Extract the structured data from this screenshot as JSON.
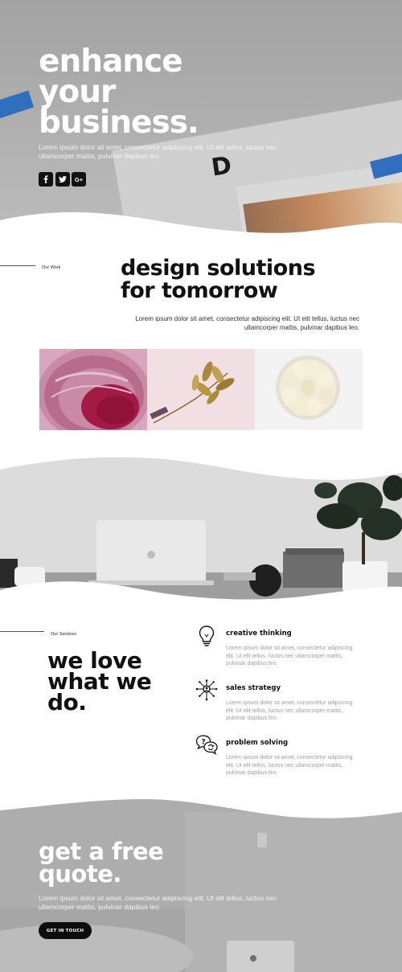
{
  "hero": {
    "title_line1": "enhance",
    "title_line2": "your",
    "title_line3": "business.",
    "text": "Lorem ipsum dolor sit amet, consectetur adipiscing elit. Ut elit tellus, luctus nec ullamcorper mattis, pulvinar dapibus leo.",
    "letter": "D",
    "social": [
      {
        "icon": "facebook-icon",
        "glyph": "f"
      },
      {
        "icon": "twitter-icon",
        "glyph": "t"
      },
      {
        "icon": "google-plus-icon",
        "glyph": "G+"
      }
    ]
  },
  "work": {
    "label": "Our Work",
    "title_line1": "design solutions",
    "title_line2": "for tomorrow",
    "text": "Lorem ipsum dolor sit amet, consectetur adipiscing elit. Ut elit tellus, luctus nec ullamcorper mattis, pulvinar dapibus leo.",
    "gallery": [
      "pink-dish-photo",
      "gold-branch-photo",
      "garlic-photo"
    ]
  },
  "services": {
    "label": "Our Services",
    "title_line1": "we love",
    "title_line2": "what we",
    "title_line3": "do.",
    "items": [
      {
        "icon": "lightbulb-icon",
        "name": "creative thinking",
        "desc": "Lorem ipsum dolor sit amet, consectetur adipiscing elit. Ut elit tellus, luctus nec ullamcorper mattis, pulvinar dapibus leo."
      },
      {
        "icon": "network-icon",
        "name": "sales strategy",
        "desc": "Lorem ipsum dolor sit amet, consectetur adipiscing elit. Ut elit tellus, luctus nec ullamcorper mattis, pulvinar dapibus leo."
      },
      {
        "icon": "question-bubbles-icon",
        "name": "problem solving",
        "desc": "Lorem ipsum dolor sit amet, consectetur adipiscing elit. Ut elit tellus, luctus nec ullamcorper mattis, pulvinar dapibus leo."
      }
    ]
  },
  "quote": {
    "title_line1": "get a free",
    "title_line2": "quote.",
    "text": "Lorem ipsum dolor sit amet, consectetur adipiscing elit. Ut elit tellus, luctus nec ullamcorper mattis, pulvinar dapibus leo.",
    "button": "GET IN TOUCH"
  },
  "colors": {
    "accent": "#111111",
    "hero_overlay": "#a8a8a8",
    "body_text_muted": "#a0a0a0"
  }
}
